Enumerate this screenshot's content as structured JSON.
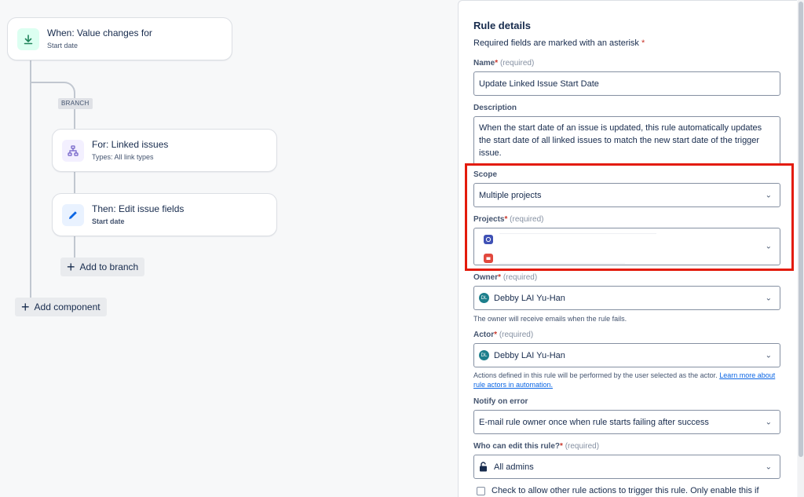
{
  "canvas": {
    "trigger": {
      "title": "When: Value changes for",
      "subtitle": "Start date",
      "icon": "download-arrow-icon"
    },
    "branch_label": "BRANCH",
    "branch_node": {
      "title": "For: Linked issues",
      "subtitle": "Types: All link types",
      "icon": "hierarchy-icon"
    },
    "action_node": {
      "title": "Then: Edit issue fields",
      "subtitle": "Start date",
      "icon": "pencil-icon"
    },
    "add_to_branch": "Add to branch",
    "add_component": "Add component"
  },
  "panel": {
    "title": "Rule details",
    "required_note": "Required fields are marked with an asterisk",
    "asterisk": "*",
    "required_hint": "(required)",
    "name": {
      "label": "Name",
      "value": "Update Linked Issue Start Date"
    },
    "description": {
      "label": "Description",
      "value": "When the start date of an issue is updated, this rule automatically updates the start date of all linked issues to match the new start date of the trigger issue."
    },
    "scope": {
      "label": "Scope",
      "value": "Multiple projects"
    },
    "projects": {
      "label": "Projects",
      "items": [
        "project-1",
        "project-2"
      ]
    },
    "owner": {
      "label": "Owner",
      "value": "Debby LAI Yu-Han",
      "helper": "The owner will receive emails when the rule fails."
    },
    "actor": {
      "label": "Actor",
      "value": "Debby LAI Yu-Han",
      "helper": "Actions defined in this rule will be performed by the user selected as the actor.",
      "link": "Learn more about rule actors in automation."
    },
    "notify": {
      "label": "Notify on error",
      "value": "E-mail rule owner once when rule starts failing after success"
    },
    "who_can_edit": {
      "label": "Who can edit this rule?",
      "value": "All admins"
    },
    "checkbox_label": "Check to allow other rule actions to trigger this rule. Only enable this if"
  },
  "colors": {
    "highlight": "#e31b0c",
    "accent": "#0c66e4",
    "star": "#c9372c"
  }
}
